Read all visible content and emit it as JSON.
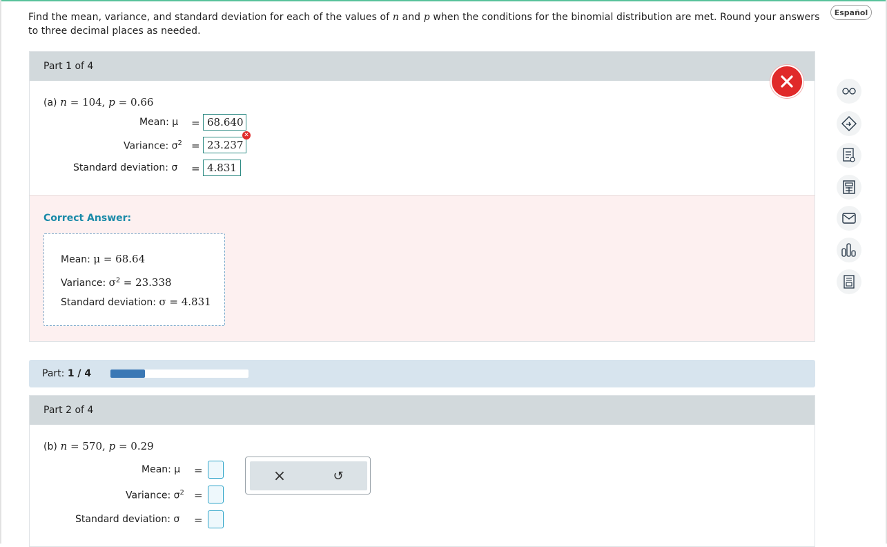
{
  "header": {
    "language_button": "Español",
    "question_prefix": "Find the mean, variance, and standard deviation for each of the values of",
    "question_n": "n",
    "question_and": "and",
    "question_p": "p",
    "question_suffix": "when the conditions for the binomial distribution are met. Round your answers to three decimal places as needed."
  },
  "part1": {
    "header": "Part 1 of 4",
    "label_prefix": "(a)",
    "n_var": "n",
    "n_value": "= 104,",
    "p_var": "p",
    "p_value": "= 0.66",
    "mean_label": "Mean: μ",
    "variance_label": "Variance: σ",
    "variance_sup": "2",
    "sd_label": "Standard deviation: σ",
    "eq": "=",
    "mean_answer": "68.640",
    "variance_answer": "23.237",
    "sd_answer": "4.831",
    "correct_title": "Correct Answer:",
    "correct_mean_label": "Mean:",
    "correct_mean_value": "μ = 68.64",
    "correct_variance_label": "Variance:",
    "correct_variance_value_sym": "σ",
    "correct_variance_sup": "2",
    "correct_variance_value": "= 23.338",
    "correct_sd_label": "Standard deviation:",
    "correct_sd_value": "σ = 4.831"
  },
  "progress": {
    "label": "Part:",
    "value": "1 / 4",
    "fraction": 0.25
  },
  "part2": {
    "header": "Part 2 of 4",
    "label_prefix": "(b)",
    "n_var": "n",
    "n_value": "= 570,",
    "p_var": "p",
    "p_value": "= 0.29",
    "mean_label": "Mean: μ",
    "variance_label": "Variance: σ",
    "variance_sup": "2",
    "sd_label": "Standard deviation: σ",
    "eq": "="
  },
  "popover": {
    "clear_icon": "×",
    "undo_icon": "↺"
  },
  "sidebar_tools": [
    {
      "icon": "glasses-icon"
    },
    {
      "icon": "tag-icon"
    },
    {
      "icon": "notepad-icon"
    },
    {
      "icon": "calculator-icon"
    },
    {
      "icon": "mail-icon"
    },
    {
      "icon": "bar-chart-icon"
    },
    {
      "icon": "report-icon"
    }
  ],
  "colors": {
    "accent": "#1a8aa8",
    "error": "#e02a2a",
    "progress": "#3a78b5"
  }
}
